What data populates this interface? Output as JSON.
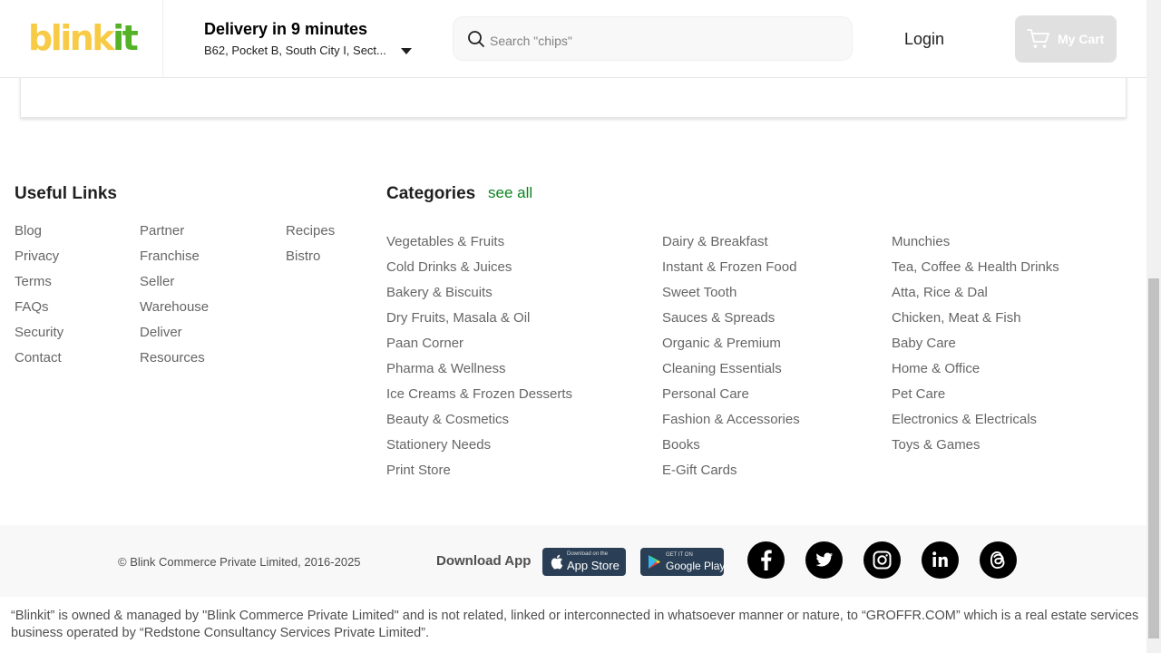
{
  "brand": {
    "logo_part1": "blink",
    "logo_part2": "it",
    "colors": {
      "yellow": "#f8cb46",
      "green": "#54b226"
    }
  },
  "header": {
    "delivery_title": "Delivery in 9 minutes",
    "address": "B62, Pocket B, South City I, Sect...",
    "search_placeholder": "Search \"chips\"",
    "login_label": "Login",
    "cart_label": "My Cart"
  },
  "useful_links": {
    "title": "Useful Links",
    "col1": [
      "Blog",
      "Privacy",
      "Terms",
      "FAQs",
      "Security",
      "Contact"
    ],
    "col2": [
      "Partner",
      "Franchise",
      "Seller",
      "Warehouse",
      "Deliver",
      "Resources"
    ],
    "col3": [
      "Recipes",
      "Bistro"
    ]
  },
  "categories": {
    "title": "Categories",
    "see_all": "see all",
    "col1": [
      "Vegetables & Fruits",
      "Cold Drinks & Juices",
      "Bakery & Biscuits",
      "Dry Fruits, Masala & Oil",
      "Paan Corner",
      "Pharma & Wellness",
      "Ice Creams & Frozen Desserts",
      "Beauty & Cosmetics",
      "Stationery Needs",
      "Print Store"
    ],
    "col2": [
      "Dairy & Breakfast",
      "Instant & Frozen Food",
      "Sweet Tooth",
      "Sauces & Spreads",
      "Organic & Premium",
      "Cleaning Essentials",
      "Personal Care",
      "Fashion & Accessories",
      "Books",
      "E-Gift Cards"
    ],
    "col3": [
      "Munchies",
      "Tea, Coffee & Health Drinks",
      "Atta, Rice & Dal",
      "Chicken, Meat & Fish",
      "Baby Care",
      "Home & Office",
      "Pet Care",
      "Electronics & Electricals",
      "Toys & Games"
    ]
  },
  "footer": {
    "copyright": "© Blink Commerce Private Limited, 2016-2025",
    "download_label": "Download App",
    "app_store": {
      "small": "Download on the",
      "big": "App Store"
    },
    "google_play": {
      "small": "GET IT ON",
      "big": "Google Play"
    },
    "social_icons": [
      "facebook-icon",
      "twitter-icon",
      "instagram-icon",
      "linkedin-icon",
      "threads-icon"
    ],
    "disclaimer": "“Blinkit” is owned & managed by \"Blink Commerce Private Limited\" and is not related, linked or interconnected in whatsoever manner or nature, to “GROFFR.COM” which is a real estate services business operated by “Redstone Consultancy Services Private Limited”."
  }
}
